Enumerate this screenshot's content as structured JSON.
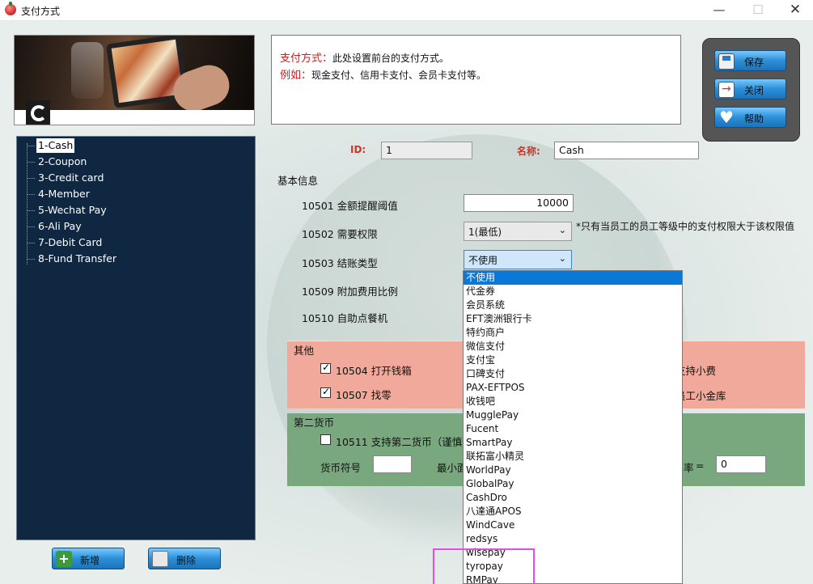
{
  "window": {
    "title": "支付方式",
    "minimize": "—",
    "maximize": "☐",
    "close": "✕"
  },
  "info": {
    "line1_label": "支付方式：",
    "line1_text": "此处设置前台的支付方式。",
    "line2_label": "例如：",
    "line2_text": "现金支付、信用卡支付、会员卡支付等。"
  },
  "actions": {
    "save": "保存",
    "close": "关闭",
    "help": "帮助"
  },
  "tree": {
    "items": [
      {
        "label": "1-Cash",
        "selected": true
      },
      {
        "label": "2-Coupon"
      },
      {
        "label": "3-Credit card"
      },
      {
        "label": "4-Member"
      },
      {
        "label": "5-Wechat Pay"
      },
      {
        "label": "6-Ali Pay"
      },
      {
        "label": "7-Debit Card"
      },
      {
        "label": "8-Fund Transfer"
      }
    ]
  },
  "bottom": {
    "add": "新增",
    "delete": "删除"
  },
  "form": {
    "id_label": "ID:",
    "id_value": "1",
    "name_label": "名称:",
    "name_value": "Cash",
    "basic_section": "基本信息",
    "f10501": "10501 金额提醒阈值",
    "f10501_value": "10000",
    "f10502": "10502 需要权限",
    "f10502_value": "1(最低)",
    "f10502_note": "*只有当员工的员工等级中的支付权限大于该权限值",
    "f10503": "10503 结账类型",
    "f10503_value": "不使用",
    "f10509": "10509 附加费用比例",
    "f10510": "10510 自助点餐机"
  },
  "other": {
    "title": "其他",
    "c10504": "10504 打开钱箱",
    "c10504_checked": true,
    "c10507": "10507 找零",
    "c10507_checked": true,
    "right1": "支持小费",
    "right2": "员工小金库"
  },
  "second_currency": {
    "title": "第二货币",
    "c10511": "10511 支持第二货币（谨慎修",
    "symbol_label": "货币符号",
    "symbol_value": "",
    "min_label": "最小面",
    "rate_tail": "率",
    "equals": "=",
    "rate_value": "0"
  },
  "checkout_options": [
    "不使用",
    "代金券",
    "会员系统",
    "EFT澳洲银行卡",
    "特约商户",
    "微信支付",
    "支付宝",
    "口碑支付",
    "PAX-EFTPOS",
    "收钱吧",
    "MugglePay",
    "Fucent",
    "SmartPay",
    "联拓富小精灵",
    "WorldPay",
    "GlobalPay",
    "CashDro",
    "八達通APOS",
    "WindCave",
    "redsys",
    "wisepay",
    "tyropay",
    "RMPay"
  ],
  "checkout_selected_index": 0
}
